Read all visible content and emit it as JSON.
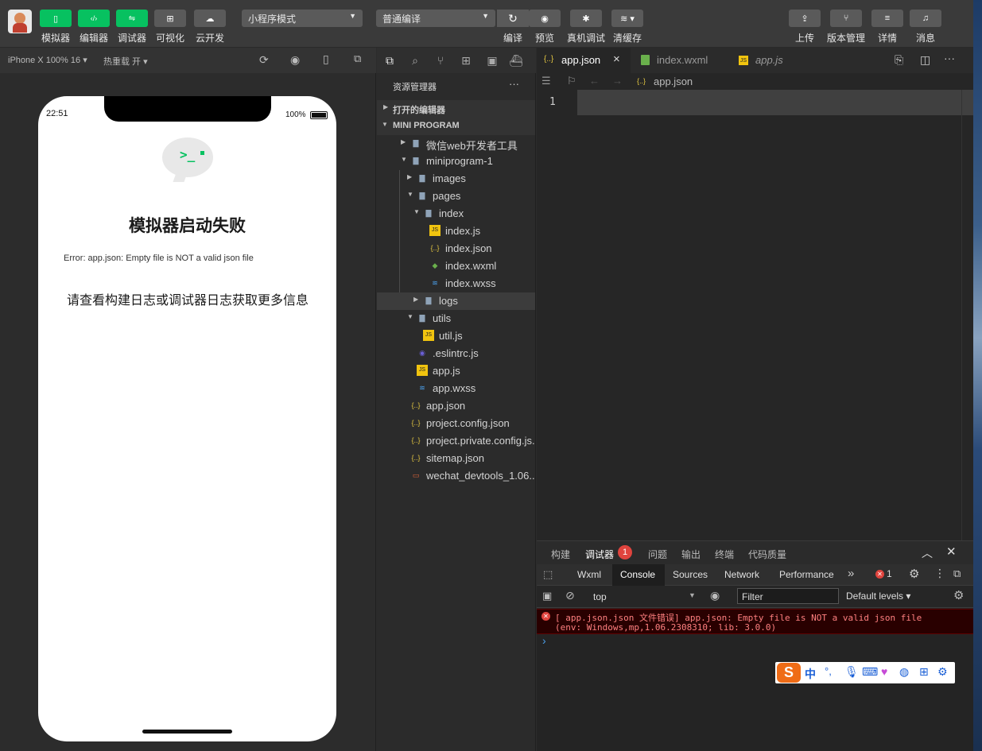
{
  "toolbar": {
    "buttons": [
      {
        "label": "模拟器",
        "icon": "phone-icon"
      },
      {
        "label": "编辑器",
        "icon": "code-icon"
      },
      {
        "label": "调试器",
        "icon": "sliders-icon"
      },
      {
        "label": "可视化",
        "icon": "layout-icon"
      },
      {
        "label": "云开发",
        "icon": "cloud-icon"
      }
    ],
    "mode_select": "小程序模式",
    "compile_select": "普通编译",
    "actions": [
      {
        "label": "编译",
        "icon": "refresh-icon"
      },
      {
        "label": "预览",
        "icon": "eye-icon"
      },
      {
        "label": "真机调试",
        "icon": "bug-icon"
      },
      {
        "label": "清缓存",
        "icon": "layers-icon"
      }
    ],
    "right_actions": [
      {
        "label": "上传",
        "icon": "upload-icon"
      },
      {
        "label": "版本管理",
        "icon": "branch-icon"
      },
      {
        "label": "详情",
        "icon": "menu-icon"
      },
      {
        "label": "消息",
        "icon": "bell-icon"
      }
    ]
  },
  "simulator": {
    "device": "iPhone X 100% 16",
    "hot_reload": "热重载 开",
    "status_time": "22:51",
    "battery": "100%",
    "error_title": "模拟器启动失败",
    "error_detail": "Error: app.json: Empty file is NOT a valid json file",
    "error_hint": "请查看构建日志或调试器日志获取更多信息"
  },
  "explorer": {
    "title": "资源管理器",
    "more": "···",
    "open_editors": "打开的编辑器",
    "project": "MINI PROGRAM",
    "items": [
      {
        "label": "微信web开发者工具",
        "type": "folder"
      },
      {
        "label": "miniprogram-1",
        "type": "folder"
      },
      {
        "label": "images",
        "type": "folder"
      },
      {
        "label": "pages",
        "type": "folder"
      },
      {
        "label": "index",
        "type": "folder"
      },
      {
        "label": "index.js",
        "type": "js"
      },
      {
        "label": "index.json",
        "type": "json"
      },
      {
        "label": "index.wxml",
        "type": "wxml"
      },
      {
        "label": "index.wxss",
        "type": "wxss"
      },
      {
        "label": "logs",
        "type": "folder"
      },
      {
        "label": "utils",
        "type": "folder"
      },
      {
        "label": "util.js",
        "type": "js"
      },
      {
        "label": ".eslintrc.js",
        "type": "eslint"
      },
      {
        "label": "app.js",
        "type": "js"
      },
      {
        "label": "app.wxss",
        "type": "wxss"
      },
      {
        "label": "app.json",
        "type": "json"
      },
      {
        "label": "project.config.json",
        "type": "json"
      },
      {
        "label": "project.private.config.js...",
        "type": "json"
      },
      {
        "label": "sitemap.json",
        "type": "json"
      },
      {
        "label": "wechat_devtools_1.06....",
        "type": "file"
      }
    ]
  },
  "editor": {
    "tabs": [
      {
        "label": "app.json",
        "type": "json"
      },
      {
        "label": "index.wxml",
        "type": "wxml"
      },
      {
        "label": "app.js",
        "type": "js"
      }
    ],
    "close": "×",
    "breadcrumb": "app.json",
    "line_number": "1"
  },
  "devtools": {
    "panel_tabs": [
      "构建",
      "调试器",
      "问题",
      "输出",
      "终端",
      "代码质量"
    ],
    "debugger_badge": "1",
    "console_tabs": [
      "Wxml",
      "Console",
      "Sources",
      "Network",
      "Performance"
    ],
    "more": "»",
    "error_count": "1",
    "context": "top",
    "filter_placeholder": "Filter",
    "levels": "Default levels",
    "error_line1": "[ app.json.json 文件错误] app.json: Empty file is NOT a valid json file",
    "error_line2": "(env: Windows,mp,1.06.2308310; lib: 3.0.0)",
    "prompt": "›"
  },
  "ime": {
    "logo": "S",
    "lang": "中",
    "punct": "°,"
  },
  "colors": {
    "accent_green": "#07c160",
    "error_red": "#e0443e",
    "json_yellow": "#e2c541",
    "js_yellow": "#f1c40f",
    "wxml_green": "#6ab04c",
    "wxss_blue": "#4b9fea"
  }
}
